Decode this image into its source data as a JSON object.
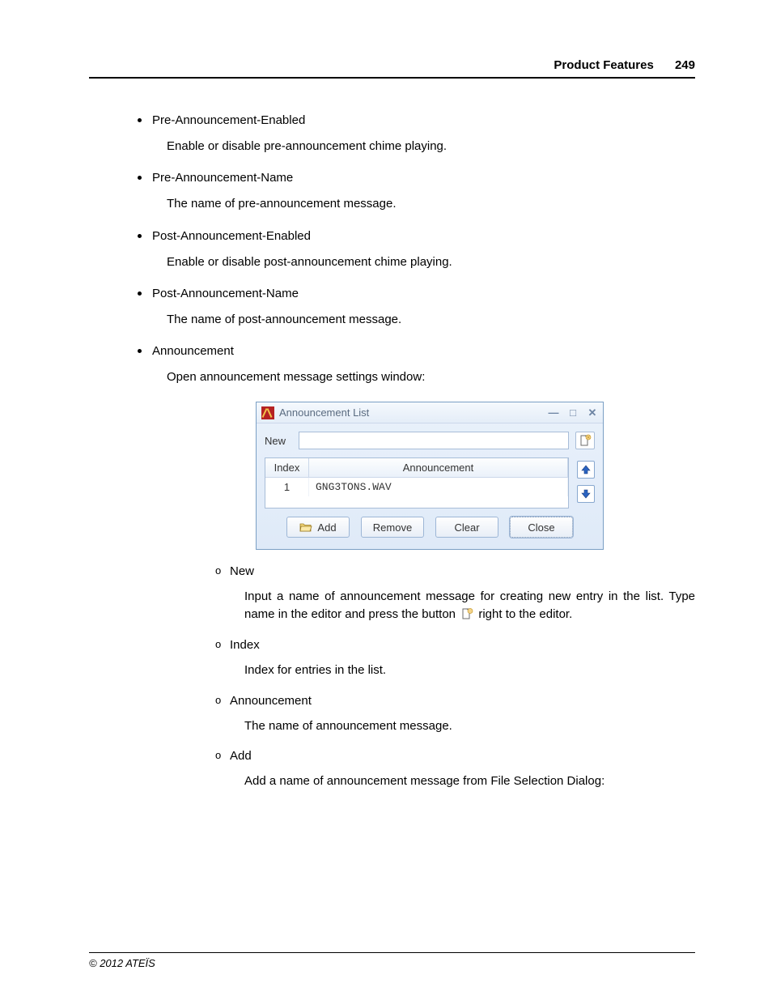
{
  "header": {
    "title": "Product Features",
    "page": "249"
  },
  "bullets": [
    {
      "term": "Pre-Announcement-Enabled",
      "desc": "Enable or disable pre-announcement chime playing."
    },
    {
      "term": "Pre-Announcement-Name",
      "desc": "The name of pre-announcement message."
    },
    {
      "term": "Post-Announcement-Enabled",
      "desc": "Enable or disable post-announcement chime playing."
    },
    {
      "term": "Post-Announcement-Name",
      "desc": "The name of post-announcement message."
    },
    {
      "term": "Announcement",
      "desc": "Open announcement message settings window:"
    }
  ],
  "window": {
    "title": "Announcement List",
    "new_label": "New",
    "new_value": "",
    "columns": {
      "index": "Index",
      "announcement": "Announcement"
    },
    "rows": [
      {
        "index": "1",
        "announcement": "GNG3TONS.WAV"
      }
    ],
    "buttons": {
      "add": "Add",
      "remove": "Remove",
      "clear": "Clear",
      "close": "Close"
    }
  },
  "sub": [
    {
      "term": "New",
      "desc_a": "Input a name of announcement message for creating new entry in the list. Type name in the editor and press the button ",
      "desc_b": " right to the editor."
    },
    {
      "term": "Index",
      "desc": "Index for entries in the list."
    },
    {
      "term": "Announcement",
      "desc": "The name of announcement message."
    },
    {
      "term": "Add",
      "desc": "Add a name of announcement message from File Selection Dialog:"
    }
  ],
  "footer": "© 2012 ATEÏS"
}
